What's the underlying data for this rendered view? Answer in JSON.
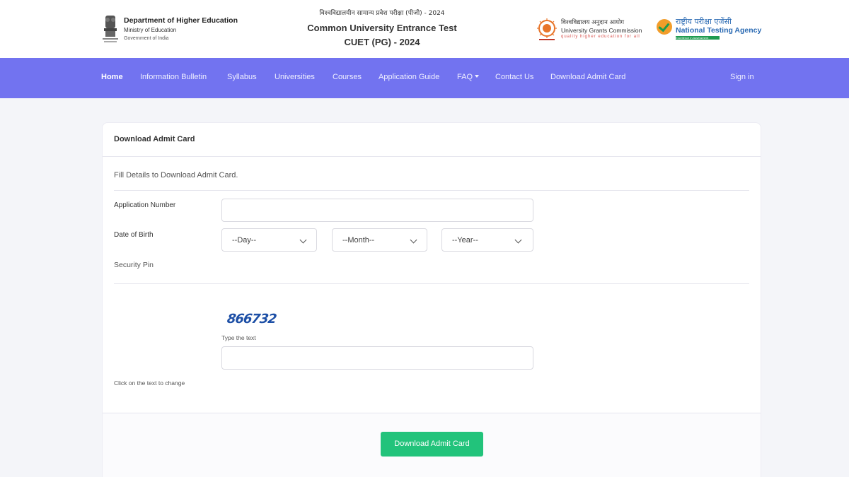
{
  "header": {
    "dept_title": "Department of Higher Education",
    "dept_ministry": "Ministry of Education",
    "dept_gov": "Government of India",
    "hindi_title": "विश्वविद्यालयीन सामान्य प्रवेश परीक्षा (पीजी) - 2024",
    "exam_title": "Common University Entrance Test",
    "exam_sub": "CUET (PG) - 2024",
    "ugc_hindi": "विश्वविद्यालय अनुदान आयोग",
    "ugc_name": "University Grants Commission",
    "ugc_tagline": "quality higher education for all",
    "nta_hindi": "राष्ट्रीय परीक्षा एजेंसी",
    "nta_name": "National Testing Agency",
    "nta_tagline": "Excellence in Assessment"
  },
  "nav": {
    "items": [
      "Home",
      "Information Bulletin",
      "Syllabus",
      "Universities",
      "Courses",
      "Application Guide",
      "FAQ",
      "Contact Us",
      "Download Admit Card"
    ],
    "sign_in": "Sign in",
    "active": "Home",
    "bg_color": "#7273f0"
  },
  "form": {
    "title": "Download Admit Card",
    "subtitle": "Fill Details to Download Admit Card.",
    "application_number_label": "Application Number",
    "application_number_value": "",
    "dob_label": "Date of Birth",
    "day_selected": "--Day--",
    "month_selected": "--Month--",
    "year_selected": "--Year--",
    "security_pin_label": "Security Pin",
    "captcha_text": "866732",
    "type_text_label": "Type the text",
    "captcha_input_value": "",
    "change_hint": "Click on the text to change",
    "submit_label": "Download Admit Card",
    "button_color": "#22c37b"
  }
}
